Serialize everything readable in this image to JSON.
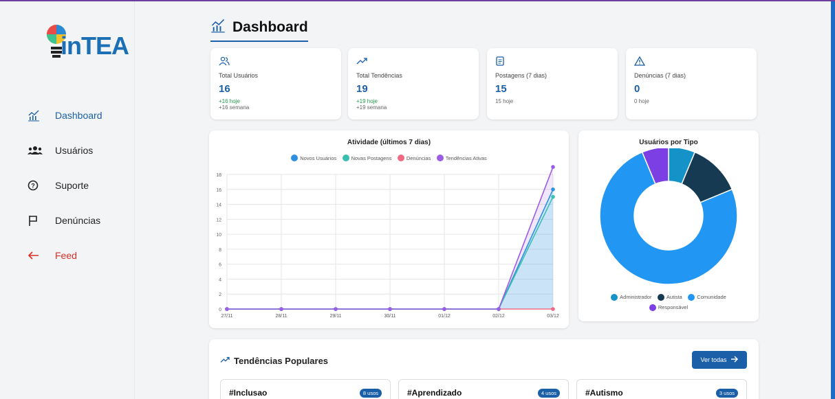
{
  "app": {
    "logo_text": "inTEA"
  },
  "sidebar": {
    "items": [
      {
        "label": "Dashboard"
      },
      {
        "label": "Usuários"
      },
      {
        "label": "Suporte"
      },
      {
        "label": "Denúncias"
      },
      {
        "label": "Feed"
      }
    ]
  },
  "header": {
    "title": "Dashboard"
  },
  "stats": [
    {
      "label": "Total Usuários",
      "value": "16",
      "sub1": "+16 hoje",
      "sub2": "+16 semana"
    },
    {
      "label": "Total Tendências",
      "value": "19",
      "sub1": "+19 hoje",
      "sub2": "+19 semana"
    },
    {
      "label": "Postagens (7 dias)",
      "value": "15",
      "sub1": "15 hoje",
      "sub2": ""
    },
    {
      "label": "Denúncias (7 dias)",
      "value": "0",
      "sub1": "0 hoje",
      "sub2": ""
    }
  ],
  "activity_chart": {
    "title": "Atividade (últimos 7 dias)",
    "legend": [
      "Novos Usuários",
      "Novas Postagens",
      "Denúncias",
      "Tendências Ativas"
    ],
    "y_ticks": [
      "0",
      "2",
      "4",
      "6",
      "8",
      "10",
      "12",
      "14",
      "16",
      "18"
    ],
    "x_labels": [
      "27/11",
      "28/11",
      "29/11",
      "30/11",
      "01/12",
      "02/12",
      "03/12"
    ]
  },
  "type_chart": {
    "title": "Usuários por Tipo",
    "legend": [
      "Administrador",
      "Autista",
      "Comunidade",
      "Responsável"
    ]
  },
  "chart_data": [
    {
      "type": "line",
      "title": "Atividade (últimos 7 dias)",
      "categories": [
        "27/11",
        "28/11",
        "29/11",
        "30/11",
        "01/12",
        "02/12",
        "03/12"
      ],
      "series": [
        {
          "name": "Novos Usuários",
          "color": "#2f8fe0",
          "values": [
            0,
            0,
            0,
            0,
            0,
            0,
            16
          ]
        },
        {
          "name": "Novas Postagens",
          "color": "#3bbfb3",
          "values": [
            0,
            0,
            0,
            0,
            0,
            0,
            15
          ]
        },
        {
          "name": "Denúncias",
          "color": "#f06a85",
          "values": [
            0,
            0,
            0,
            0,
            0,
            0,
            0
          ]
        },
        {
          "name": "Tendências Ativas",
          "color": "#9b5de5",
          "values": [
            0,
            0,
            0,
            0,
            0,
            0,
            19
          ]
        }
      ],
      "ylim": [
        0,
        18
      ],
      "legend_position": "top"
    },
    {
      "type": "pie",
      "title": "Usuários por Tipo",
      "categories": [
        "Administrador",
        "Autista",
        "Comunidade",
        "Responsável"
      ],
      "values": [
        1,
        2,
        12,
        1
      ],
      "colors": [
        "#1593c9",
        "#163a52",
        "#2196f3",
        "#7b3fe4"
      ],
      "legend_position": "bottom"
    }
  ],
  "trends": {
    "title": "Tendências Populares",
    "view_all": "Ver todas",
    "items": [
      {
        "name": "#Inclusao",
        "badge": "8 usos"
      },
      {
        "name": "#Aprendizado",
        "badge": "4 usos"
      },
      {
        "name": "#Autismo",
        "badge": "3 usos"
      }
    ]
  },
  "colors": {
    "accent": "#1a5fa8",
    "danger": "#d93025",
    "positive": "#1e9e4a"
  }
}
